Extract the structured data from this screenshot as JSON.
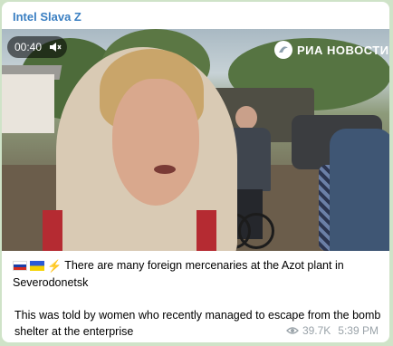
{
  "message": {
    "channel_name": "Intel Slava Z",
    "video": {
      "duration": "00:40",
      "mute_icon": "speaker-muted-icon",
      "watermark_text": "РИА НОВОСТИ",
      "watermark_icon": "ria-logo-icon"
    },
    "text": {
      "flags": [
        "russia-flag-icon",
        "ukraine-flag-icon",
        "lightning-icon"
      ],
      "paragraph1": "There are many foreign mercenaries at the Azot plant in Severodonetsk",
      "paragraph2": "This was told by women who recently managed to escape from the bomb shelter at the enterprise"
    },
    "views": "39.7K",
    "time": "5:39 PM"
  },
  "colors": {
    "channel_name": "#3a7fc2",
    "background": "#cfe3c8",
    "meta": "#9aa3a9"
  }
}
